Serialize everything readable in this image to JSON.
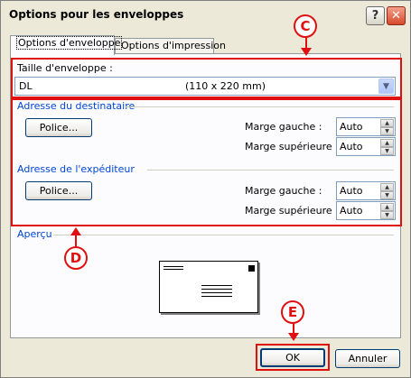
{
  "window": {
    "title": "Options pour les enveloppes",
    "help_label": "?",
    "close_label": "✕"
  },
  "tabs": [
    {
      "label": "Options d'enveloppe",
      "active": true
    },
    {
      "label": "Options d'impression",
      "active": false
    }
  ],
  "envelope_size": {
    "label": "Taille d'enveloppe :",
    "selected_name": "DL",
    "selected_dims": "(110 x 220 mm)"
  },
  "recipient": {
    "group_title": "Adresse du destinataire",
    "font_button": "Police...",
    "left_margin_label": "Marge gauche :",
    "left_margin_value": "Auto",
    "top_margin_label": "Marge supérieure :",
    "top_margin_value": "Auto"
  },
  "sender": {
    "group_title": "Adresse de l'expéditeur",
    "font_button": "Police...",
    "left_margin_label": "Marge gauche :",
    "left_margin_value": "Auto",
    "top_margin_label": "Marge supérieure :",
    "top_margin_value": "Auto"
  },
  "preview": {
    "group_title": "Aperçu"
  },
  "buttons": {
    "ok": "OK",
    "cancel": "Annuler"
  },
  "callouts": {
    "c": "C",
    "d": "D",
    "e": "E"
  },
  "colors": {
    "callout_red": "#e01010",
    "group_title_blue": "#0046d5",
    "dialog_bg": "#ece9d8"
  }
}
